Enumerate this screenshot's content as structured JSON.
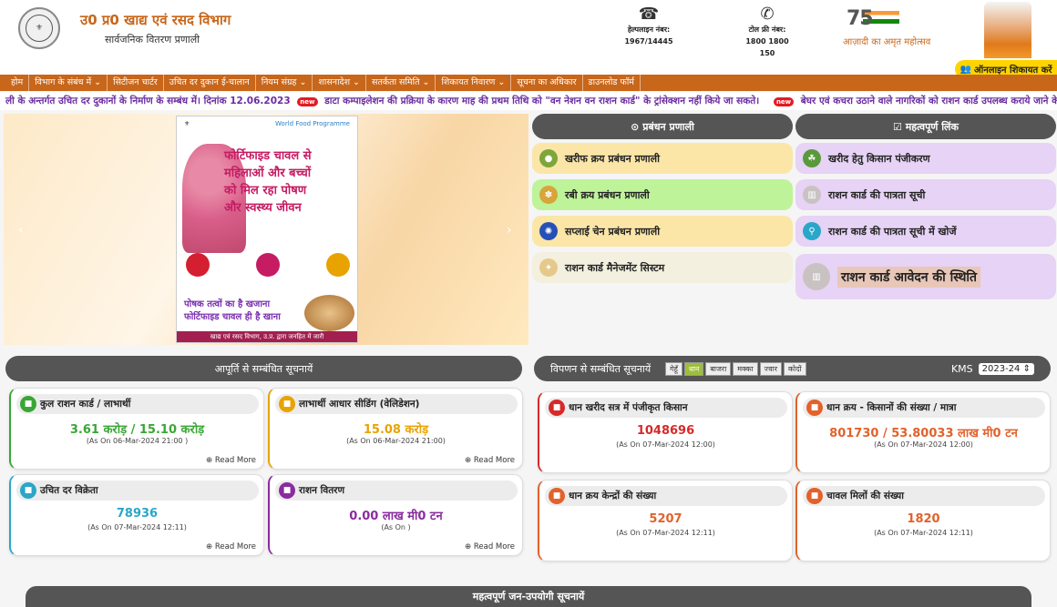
{
  "header": {
    "dept_title": "उ0 प्र0 खाद्य एवं रसद विभाग",
    "dept_sub": "सार्वजनिक वितरण प्रणाली",
    "helpline_label": "हेल्पलाइन नंबर:",
    "helpline_number": "1967/14445",
    "tollfree_label": "टोल फ्री नंबर:",
    "tollfree_number": "1800 1800 150",
    "azadi_num": "75",
    "azadi_text": "आज़ादी का अमृत महोत्सव",
    "complaint": "ऑनलाइन शिकायत करें"
  },
  "nav": [
    "होम",
    "विभाग के संबंध में ⌄",
    "सिटीजन चार्टर",
    "उचित दर दुकान ई-चालान",
    "नियम संग्रह ⌄",
    "शासनादेश ⌄",
    "सतर्कता समिति ⌄",
    "शिकायत निवारण ⌄",
    "सूचना का अधिकार",
    "डाउनलोड फॉर्म"
  ],
  "ticker": {
    "t1": "ली के अन्तर्गत उचित दर दुकानों के निर्माण के सम्बंध में। दिनांक 12.06.2023",
    "new": "new",
    "t2": "डाटा कम्पाइलेशन की प्रक्रिया के कारण माह की प्रथम तिथि को \"वन नेशन वन राशन कार्ड\" के ट्रांसेक्शन नहीं किये जा सकते।",
    "t3": "बेघर एवं कचरा उठाने वाले नागरिकों को राशन कार्ड उपलब्ध कराये जाने के संबंध"
  },
  "poster": {
    "headline": "फोर्टिफाइड चावल से महिलाओं और बच्चों को मिल रहा पोषण और स्वस्थ्य जीवन",
    "tagline": "पोषक तत्वों का है खजाना फोर्टिफाइड चावल ही है खाना",
    "footer": "खाद्य एवं रसद विभाग, उ.प्र. द्वारा जनहित में जारी",
    "badge": "World Food Programme"
  },
  "management": {
    "title": "⊙ प्रबंधन प्रणाली",
    "items": [
      "खरीफ क्रय प्रबंधन प्रणाली",
      "रबी क्रय प्रबंधन प्रणाली",
      "सप्लाई चेन प्रबंधन प्रणाली",
      "राशन कार्ड मैनेजमेंट सिस्टम"
    ]
  },
  "links": {
    "title": "☑ महत्वपूर्ण लिंक",
    "items": [
      "खरीद हेतु किसान पंजीकरण",
      "राशन कार्ड की पात्रता सूची",
      "राशन कार्ड की पात्रता सूची में खोजें",
      "राशन कार्ड आवेदन की स्थिति"
    ]
  },
  "supply": {
    "title": "आपूर्ति से सम्बंधित सूचनायें",
    "cards": [
      {
        "title": "कुल राशन कार्ड / लाभार्थी",
        "value": "3.61 करोड़ / 15.10 करोड़",
        "asof": "(As On 06-Mar-2024 21:00 )",
        "more": "Read More",
        "color": "#3aa635"
      },
      {
        "title": "लाभार्थी आधार सीडिंग (वेलिडेशन)",
        "value": "15.08 करोड़",
        "asof": "(As On 06-Mar-2024 21:00)",
        "more": "Read More",
        "color": "#e8a300"
      },
      {
        "title": "उचित दर विक्रेता",
        "value": "78936",
        "asof": "(As On 07-Mar-2024 12:11)",
        "more": "Read More",
        "color": "#2aa6c8"
      },
      {
        "title": "राशन वितरण",
        "value": "0.00 लाख मी0 टन",
        "asof": "(As On )",
        "more": "Read More",
        "color": "#8a2c9e"
      }
    ]
  },
  "marketing": {
    "title": "विपणन से सम्बंधित सूचनायें",
    "crops": [
      "गेहूँ",
      "धान",
      "बाजरा",
      "मक्का",
      "ज्वार",
      "कोदों"
    ],
    "kms_label": "KMS",
    "kms_value": "2023-24",
    "cards": [
      {
        "title": "धान खरीद सत्र में पंजीकृत किसान",
        "value": "1048696",
        "asof": "(As On 07-Mar-2024 12:00)",
        "color": "#d62a2a"
      },
      {
        "title": "धान क्रय - किसानों की संख्या / मात्रा",
        "value": "801730 / 53.80033 लाख मी0 टन",
        "asof": "(As On 07-Mar-2024 12:00)",
        "color": "#e2622a"
      },
      {
        "title": "धान क्रय केन्द्रों की संख्या",
        "value": "5207",
        "asof": "(As On 07-Mar-2024 12:11)",
        "color": "#e2622a"
      },
      {
        "title": "चावल मिलों की संख्या",
        "value": "1820",
        "asof": "(As On 07-Mar-2024 12:11)",
        "color": "#e2622a"
      }
    ]
  },
  "bottom_title": "महत्वपूर्ण जन-उपयोगी सूचनायें"
}
